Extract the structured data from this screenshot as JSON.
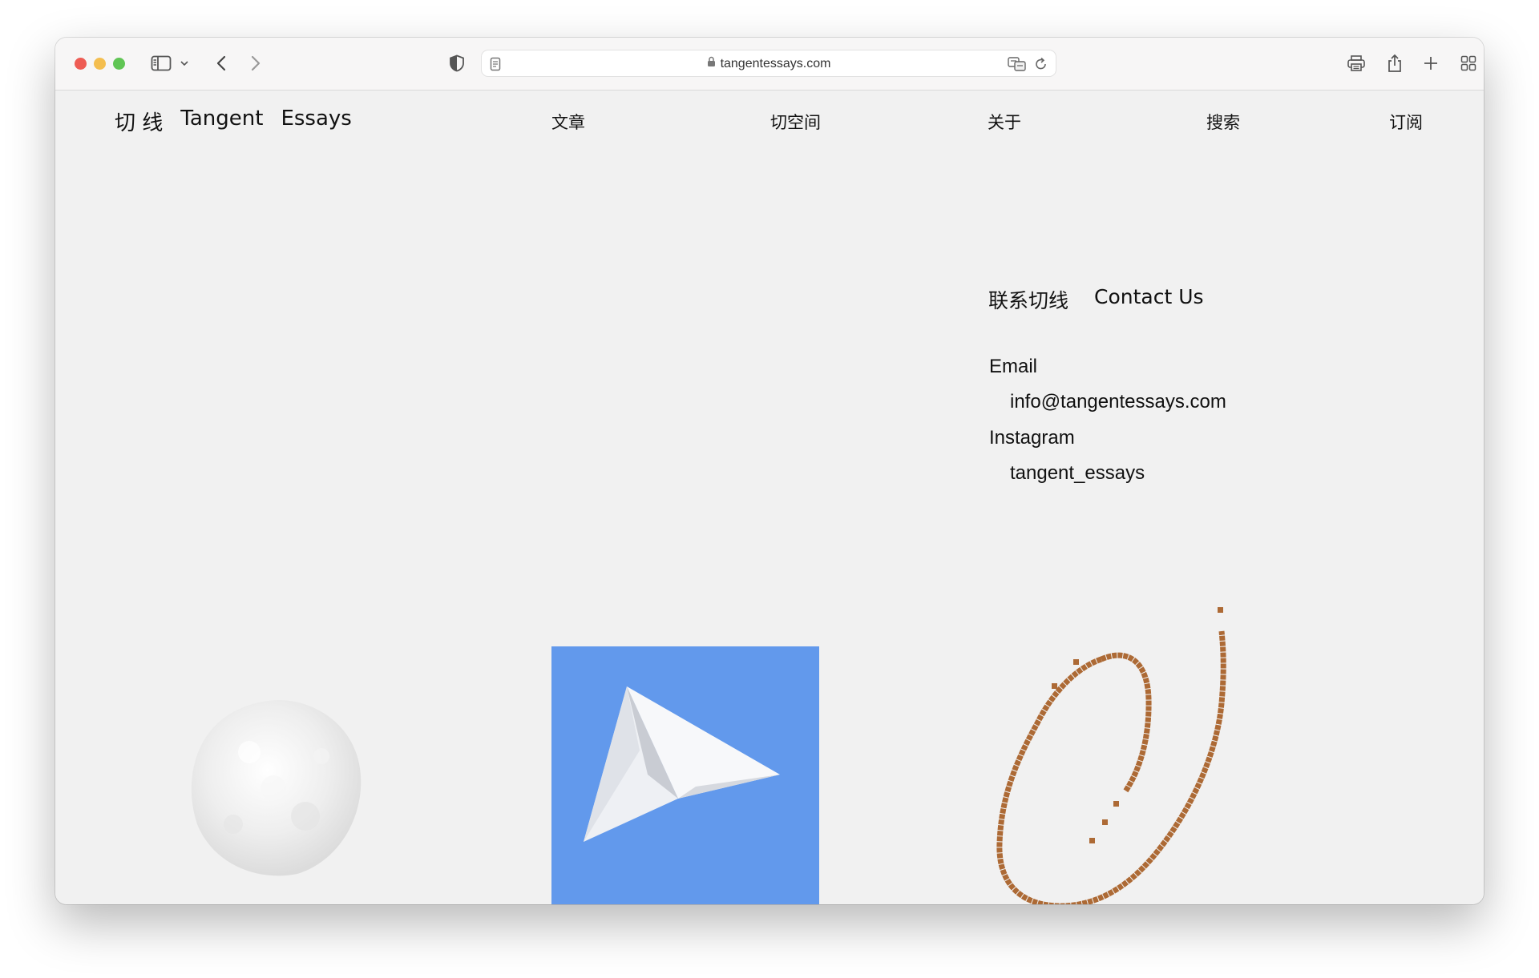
{
  "browser": {
    "url": "tangentessays.com",
    "traffic_lights": {
      "close": "#ee5c54",
      "minimize": "#f4be4f",
      "maximize": "#60c554"
    }
  },
  "site": {
    "brand": {
      "cn": "切 线",
      "en1": "Tangent",
      "en2": "Essays"
    },
    "nav": [
      {
        "label": "文章"
      },
      {
        "label": "切空间"
      },
      {
        "label": "关于"
      },
      {
        "label": "搜索"
      },
      {
        "label": "订阅"
      }
    ]
  },
  "contact": {
    "title_cn": "联系切线",
    "title_en": "Contact Us",
    "email_label": "Email",
    "email_value": "info@tangentessays.com",
    "instagram_label": "Instagram",
    "instagram_value": "tangent_essays"
  },
  "artwork": {
    "plane_bg_color": "#6299ec",
    "scribble_color": "#ad6a35",
    "snowball_color": "#e6e6e6"
  }
}
